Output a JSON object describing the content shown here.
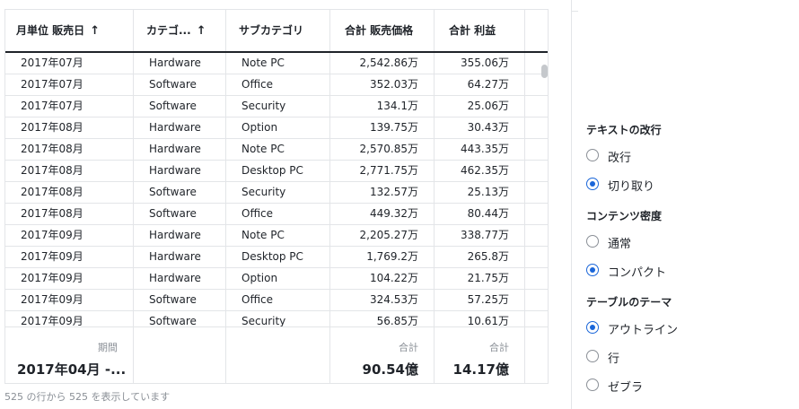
{
  "table": {
    "headers": [
      {
        "label": "月単位 販売日",
        "sort": "↑"
      },
      {
        "label": "カテゴ...",
        "sort": "↑"
      },
      {
        "label": "サブカテゴリ",
        "sort": ""
      },
      {
        "label": "合計 販売価格",
        "sort": ""
      },
      {
        "label": "合計 利益",
        "sort": ""
      }
    ],
    "rows": [
      [
        "2017年07月",
        "Hardware",
        "Note PC",
        "2,542.86万",
        "355.06万"
      ],
      [
        "2017年07月",
        "Software",
        "Office",
        "352.03万",
        "64.27万"
      ],
      [
        "2017年07月",
        "Software",
        "Security",
        "134.1万",
        "25.06万"
      ],
      [
        "2017年08月",
        "Hardware",
        "Option",
        "139.75万",
        "30.43万"
      ],
      [
        "2017年08月",
        "Hardware",
        "Note PC",
        "2,570.85万",
        "443.35万"
      ],
      [
        "2017年08月",
        "Hardware",
        "Desktop PC",
        "2,771.75万",
        "462.35万"
      ],
      [
        "2017年08月",
        "Software",
        "Security",
        "132.57万",
        "25.13万"
      ],
      [
        "2017年08月",
        "Software",
        "Office",
        "449.32万",
        "80.44万"
      ],
      [
        "2017年09月",
        "Hardware",
        "Note PC",
        "2,205.27万",
        "338.77万"
      ],
      [
        "2017年09月",
        "Hardware",
        "Desktop PC",
        "1,769.2万",
        "265.8万"
      ],
      [
        "2017年09月",
        "Hardware",
        "Option",
        "104.22万",
        "21.75万"
      ],
      [
        "2017年09月",
        "Software",
        "Office",
        "324.53万",
        "57.25万"
      ],
      [
        "2017年09月",
        "Software",
        "Security",
        "56.85万",
        "10.61万"
      ]
    ],
    "footer": {
      "period_label": "期間",
      "period_value": "2017年04月 -...",
      "sales_label": "合計",
      "sales_value": "90.54億",
      "profit_label": "合計",
      "profit_value": "14.17億"
    },
    "status": "525 の行から 525 を表示しています"
  },
  "panel": {
    "text_wrap": {
      "title": "テキストの改行",
      "options": [
        {
          "label": "改行",
          "checked": false
        },
        {
          "label": "切り取り",
          "checked": true
        }
      ]
    },
    "density": {
      "title": "コンテンツ密度",
      "options": [
        {
          "label": "通常",
          "checked": false
        },
        {
          "label": "コンパクト",
          "checked": true
        }
      ]
    },
    "theme": {
      "title": "テーブルのテーマ",
      "options": [
        {
          "label": "アウトライン",
          "checked": true
        },
        {
          "label": "行",
          "checked": false
        },
        {
          "label": "ゼブラ",
          "checked": false
        }
      ]
    }
  },
  "colors": {
    "accent": "#1a66d9",
    "border": "#e3e5e8",
    "muted": "#8a8f96"
  }
}
